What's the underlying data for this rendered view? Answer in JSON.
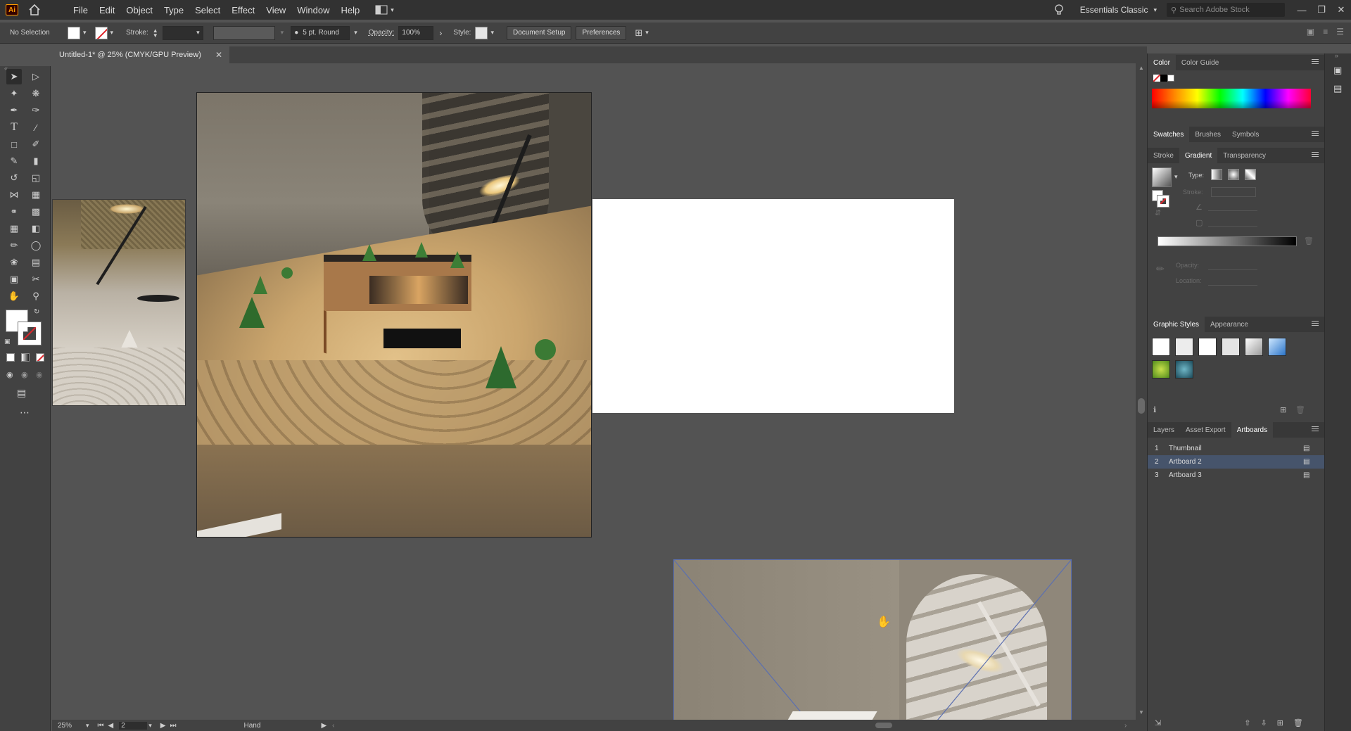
{
  "app": {
    "logo": "Ai"
  },
  "menu": [
    "File",
    "Edit",
    "Object",
    "Type",
    "Select",
    "Effect",
    "View",
    "Window",
    "Help"
  ],
  "workspace": {
    "label": "Essentials Classic",
    "search_placeholder": "Search Adobe Stock"
  },
  "control": {
    "selection": "No Selection",
    "stroke_label": "Stroke:",
    "brush": "5 pt. Round",
    "opacity_label": "Opacity:",
    "opacity_value": "100%",
    "style_label": "Style:",
    "doc_setup": "Document Setup",
    "preferences": "Preferences"
  },
  "document": {
    "tab_title": "Untitled-1* @ 25% (CMYK/GPU Preview)"
  },
  "status": {
    "zoom": "25%",
    "artboard": "2",
    "tool": "Hand"
  },
  "panels": {
    "color_tabs": [
      "Color",
      "Color Guide"
    ],
    "swatch_tabs": [
      "Swatches",
      "Brushes",
      "Symbols"
    ],
    "gradient_tabs": [
      "Stroke",
      "Gradient",
      "Transparency"
    ],
    "gradient": {
      "type_label": "Type:",
      "stroke_label": "Stroke:",
      "opacity_label": "Opacity:",
      "location_label": "Location:"
    },
    "styles_tabs": [
      "Graphic Styles",
      "Appearance"
    ],
    "layers_tabs": [
      "Layers",
      "Asset Export",
      "Artboards"
    ],
    "artboards": [
      {
        "num": "1",
        "name": "Thumbnail"
      },
      {
        "num": "2",
        "name": "Artboard 2"
      },
      {
        "num": "3",
        "name": "Artboard 3"
      }
    ]
  },
  "colors": {
    "selection_blue": "#46546b",
    "accent_orange": "#ff9a00"
  }
}
